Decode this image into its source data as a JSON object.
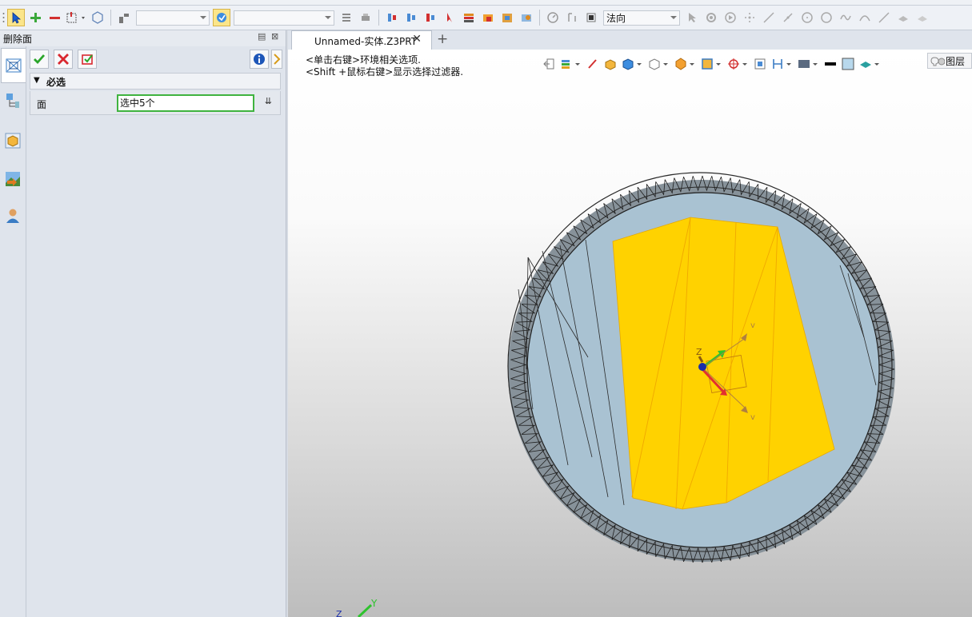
{
  "toolbar": {
    "normal_combo": "法向",
    "filter_combo": "",
    "filter_combo2": ""
  },
  "panel": {
    "title": "删除面",
    "section_label": "必选",
    "row_label": "面",
    "row_value": "选中5个"
  },
  "viewport": {
    "tab_label": "Unnamed-实体.Z3PRT",
    "hint_line1": "<单击右键>环境相关选项.",
    "hint_line2": "<Shift +鼠标右键>显示选择过滤器.",
    "layer_label": "图层",
    "axis_z": "Z",
    "axis_y": "Y",
    "triad_z": "Z"
  },
  "colors": {
    "selected_face": "#ffd200",
    "body_face": "#a7c0d1",
    "ok_green": "#2aa52a",
    "cancel_red": "#d9282f",
    "field_border": "#3fb33f"
  }
}
